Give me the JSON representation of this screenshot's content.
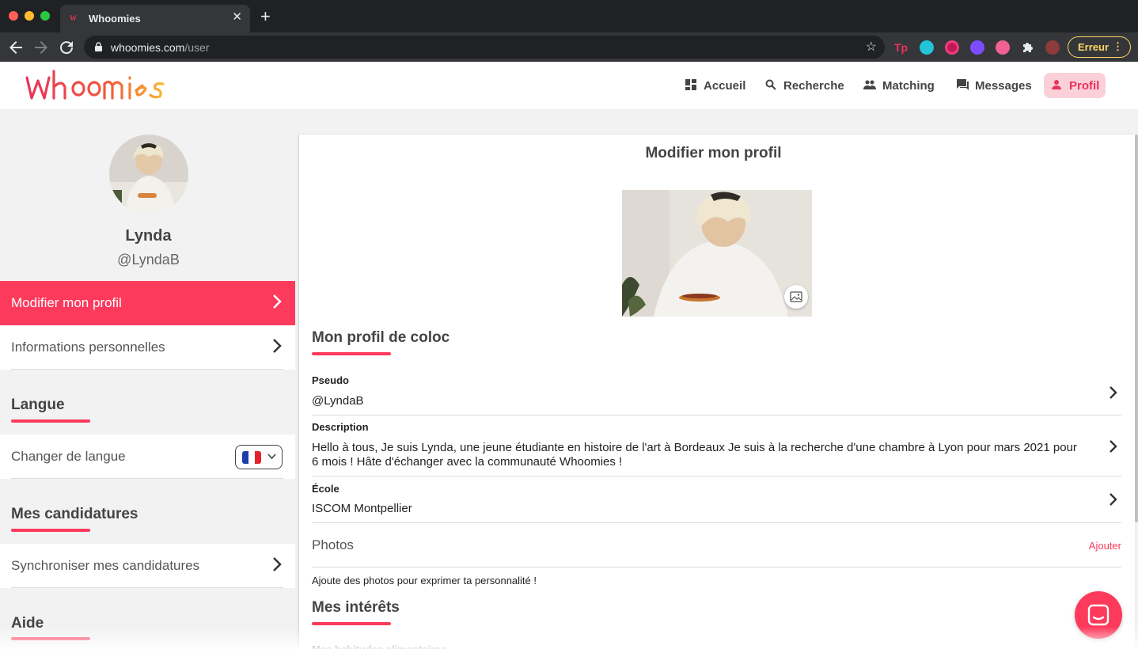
{
  "browser": {
    "tab_title": "Whoomies",
    "tab_favicon": "W",
    "url_host": "whoomies.com",
    "url_path": "/user",
    "extension_labels": [
      "Tp"
    ],
    "erreur_label": "Erreur",
    "icons": [
      "back-arrow-icon",
      "forward-arrow-icon",
      "reload-icon",
      "lock-icon",
      "star-icon",
      "puzzle-extensions-icon",
      "kebab-menu-icon"
    ]
  },
  "header": {
    "logo_text": "whoomies",
    "nav": [
      {
        "label": "Accueil",
        "icon": "dashboard-icon"
      },
      {
        "label": "Recherche",
        "icon": "search-icon"
      },
      {
        "label": "Matching",
        "icon": "people-icon"
      },
      {
        "label": "Messages",
        "icon": "chat-icon"
      },
      {
        "label": "Profil",
        "icon": "person-icon",
        "active": true
      }
    ]
  },
  "sidebar": {
    "user_name": "Lynda",
    "user_handle": "@LyndaB",
    "items": {
      "edit_profile": "Modifier mon profil",
      "personal_info": "Informations personnelles",
      "change_language": "Changer de langue",
      "sync_applications": "Synchroniser mes candidatures"
    },
    "sections": {
      "language": "Langue",
      "applications": "Mes candidatures",
      "help": "Aide"
    },
    "language_flag": "France"
  },
  "main": {
    "title": "Modifier mon profil",
    "coloc_section_title": "Mon profil de coloc",
    "fields": {
      "pseudo_label": "Pseudo",
      "pseudo_value": "@LyndaB",
      "description_label": "Description",
      "description_value": "Hello à tous, Je suis Lynda, une jeune étudiante en histoire de l'art à Bordeaux Je suis à la recherche d'une chambre à Lyon pour mars 2021 pour 6 mois ! Hâte d'échanger avec la communauté Whoomies !",
      "school_label": "École",
      "school_value": "ISCOM Montpellier"
    },
    "photos_label": "Photos",
    "photos_add": "Ajouter",
    "photos_hint": "Ajoute des photos pour exprimer ta personnalité !",
    "interests_title": "Mes intérêts",
    "cut_off_text": "Mes habitudes alimentaires"
  },
  "colors": {
    "accent": "#fd3a5c",
    "nav_active_bg": "#fbd0d9",
    "chrome_dark": "#202124",
    "chrome_toolbar": "#35363a"
  }
}
